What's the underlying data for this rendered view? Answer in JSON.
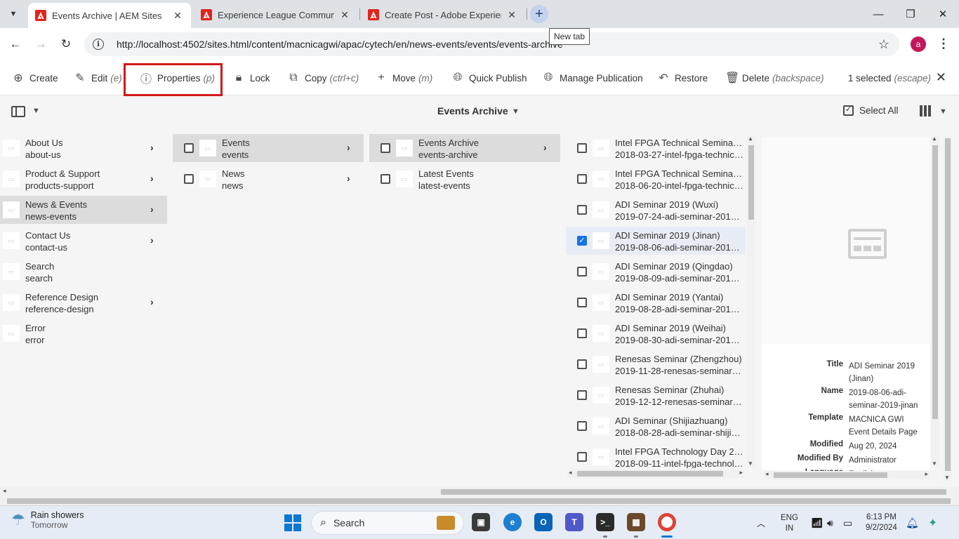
{
  "browser": {
    "tabs": [
      {
        "title": "Events Archive | AEM Sites",
        "active": true
      },
      {
        "title": "Experience League Community",
        "active": false
      },
      {
        "title": "Create Post - Adobe Experience",
        "active": false
      }
    ],
    "new_tab_tooltip": "New tab",
    "url": "http://localhost:4502/sites.html/content/macnicagwi/apac/cytech/en/news-events/events/events-archive",
    "profile_initial": "a"
  },
  "actionbar": {
    "create": "Create",
    "edit": "Edit",
    "edit_hint": "(e)",
    "properties": "Properties",
    "properties_hint": "(p)",
    "lock": "Lock",
    "copy": "Copy",
    "copy_hint": "(ctrl+c)",
    "move": "Move",
    "move_hint": "(m)",
    "quick_publish": "Quick Publish",
    "manage_publication": "Manage Publication",
    "restore": "Restore",
    "delete": "Delete",
    "delete_hint": "(backspace)",
    "selected": "1 selected",
    "selected_hint": "(escape)"
  },
  "subbar": {
    "title": "Events Archive",
    "select_all": "Select All"
  },
  "column1": [
    {
      "title": "About Us",
      "name": "about-us",
      "has_children": true,
      "selected": false
    },
    {
      "title": "Product & Support",
      "name": "products-support",
      "has_children": true,
      "selected": false
    },
    {
      "title": "News & Events",
      "name": "news-events",
      "has_children": true,
      "selected": true
    },
    {
      "title": "Contact Us",
      "name": "contact-us",
      "has_children": true,
      "selected": false
    },
    {
      "title": "Search",
      "name": "search",
      "has_children": false,
      "selected": false
    },
    {
      "title": "Reference Design",
      "name": "reference-design",
      "has_children": true,
      "selected": false
    },
    {
      "title": "Error",
      "name": "error",
      "has_children": false,
      "selected": false
    }
  ],
  "column2": [
    {
      "title": "Events",
      "name": "events",
      "has_children": true,
      "selected": true
    },
    {
      "title": "News",
      "name": "news",
      "has_children": true,
      "selected": false
    }
  ],
  "column3": [
    {
      "title": "Events Archive",
      "name": "events-archive",
      "has_children": true,
      "selected": true
    },
    {
      "title": "Latest Events",
      "name": "latest-events",
      "has_children": false,
      "selected": false
    }
  ],
  "column4": [
    {
      "title": "Intel FPGA Technical Seminar (...",
      "name": "2018-03-27-intel-fpga-technical...",
      "checked": false
    },
    {
      "title": "Intel FPGA Technical Seminar (...",
      "name": "2018-06-20-intel-fpga-technica...",
      "checked": false
    },
    {
      "title": "ADI Seminar 2019 (Wuxi)",
      "name": "2019-07-24-adi-seminar-2019-...",
      "checked": false
    },
    {
      "title": "ADI Seminar 2019 (Jinan)",
      "name": "2019-08-06-adi-seminar-2019-j...",
      "checked": true
    },
    {
      "title": "ADI Seminar 2019 (Qingdao)",
      "name": "2019-08-09-adi-seminar-2019-...",
      "checked": false
    },
    {
      "title": "ADI Seminar 2019 (Yantai)",
      "name": "2019-08-28-adi-seminar-2019-y...",
      "checked": false
    },
    {
      "title": "ADI Seminar 2019 (Weihai)",
      "name": "2019-08-30-adi-seminar-2019-...",
      "checked": false
    },
    {
      "title": "Renesas Seminar (Zhengzhou)",
      "name": "2019-11-28-renesas-seminar-zh...",
      "checked": false
    },
    {
      "title": "Renesas Seminar (Zhuhai)",
      "name": "2019-12-12-renesas-seminar-zh...",
      "checked": false
    },
    {
      "title": "ADI Seminar (Shijiazhuang)",
      "name": "2018-08-28-adi-seminar-shijiaz...",
      "checked": false
    },
    {
      "title": "Intel FPGA Technology Day 20...",
      "name": "2018-09-11-intel-fpga-technolo...",
      "checked": false
    }
  ],
  "preview": {
    "meta": [
      {
        "key": "Title",
        "value": "ADI Seminar 2019 (Jinan)"
      },
      {
        "key": "Name",
        "value": "2019-08-06-adi-seminar-2019-jinan"
      },
      {
        "key": "Template",
        "value": "MACNICA GWI Event Details Page"
      },
      {
        "key": "Modified",
        "value": "Aug 20, 2024"
      },
      {
        "key": "Modified By",
        "value": "Administrator"
      },
      {
        "key": "Language",
        "value": "English"
      }
    ]
  },
  "taskbar": {
    "weather_title": "Rain showers",
    "weather_sub": "Tomorrow",
    "search_label": "Search",
    "lang_line1": "ENG",
    "lang_line2": "IN",
    "time": "6:13 PM",
    "date": "9/2/2024"
  }
}
